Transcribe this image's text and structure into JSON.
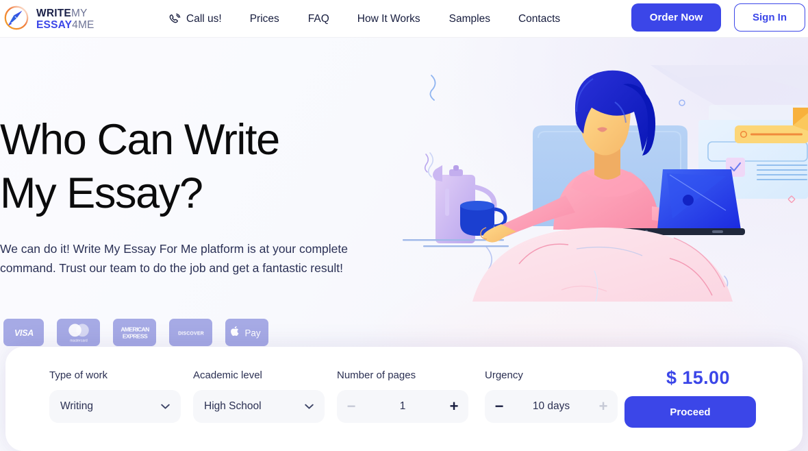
{
  "header": {
    "logo": {
      "icon": "pen-nib-logo-icon",
      "line1_bold": "WRITE",
      "line1_light": "MY",
      "line2_bold": "ESSAY",
      "line2_light": "4ME"
    },
    "nav": [
      {
        "label": "Call us!",
        "icon": "phone-icon"
      },
      {
        "label": "Prices"
      },
      {
        "label": "FAQ"
      },
      {
        "label": "How It Works"
      },
      {
        "label": "Samples"
      },
      {
        "label": "Contacts"
      }
    ],
    "order_now_label": "Order Now",
    "sign_in_label": "Sign In",
    "accent_color": "#3b46e8"
  },
  "hero": {
    "title_line1": "Who Can Write",
    "title_line2": "My Essay?",
    "subtitle": "We can do it! Write My Essay For Me platform is at your complete command. Trust our team to do the job and get a fantastic result!",
    "payment_methods": [
      {
        "name": "visa-badge",
        "label": "VISA"
      },
      {
        "name": "mastercard-badge",
        "label": "mastercard"
      },
      {
        "name": "amex-badge",
        "label": "AMERICAN EXPRESS"
      },
      {
        "name": "discover-badge",
        "label": "DISCOVER"
      },
      {
        "name": "apple-pay-badge",
        "label": "Pay"
      }
    ],
    "illustration": "woman-at-laptop-with-coffee-illustration",
    "badge_color": "#a6aae5"
  },
  "order_form": {
    "type_of_work": {
      "label": "Type of work",
      "value": "Writing"
    },
    "academic_level": {
      "label": "Academic level",
      "value": "High School"
    },
    "number_of_pages": {
      "label": "Number of pages",
      "value": "1",
      "minus": "−",
      "plus": "+",
      "minus_enabled": false,
      "plus_enabled": true
    },
    "urgency": {
      "label": "Urgency",
      "value": "10 days",
      "minus": "−",
      "plus": "+",
      "minus_enabled": true,
      "plus_enabled": false
    },
    "price": "$ 15.00",
    "proceed_label": "Proceed"
  }
}
